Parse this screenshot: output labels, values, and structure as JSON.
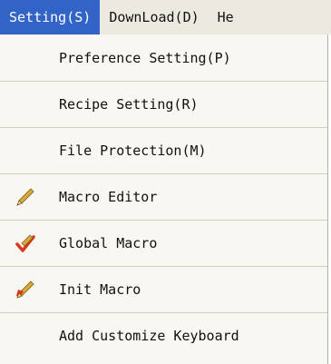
{
  "menubar": {
    "items": [
      {
        "label": "Setting(S)"
      },
      {
        "label": "DownLoad(D)"
      },
      {
        "label": "He"
      }
    ]
  },
  "dropdown": {
    "items": [
      {
        "label": "Preference Setting(P)",
        "icon": null
      },
      {
        "label": "Recipe Setting(R)",
        "icon": null
      },
      {
        "label": "File Protection(M)",
        "icon": null
      },
      {
        "label": "Macro Editor",
        "icon": "pencil-icon"
      },
      {
        "label": "Global Macro",
        "icon": "checkmark-pencil-icon"
      },
      {
        "label": "Init Macro",
        "icon": "red-pencil-icon"
      },
      {
        "label": "Add Customize Keyboard",
        "icon": null
      }
    ]
  },
  "colors": {
    "menubar_bg": "#eceae0",
    "active_bg": "#3264c8",
    "dropdown_bg": "#f8f7f2",
    "divider": "#cfcdc4"
  }
}
